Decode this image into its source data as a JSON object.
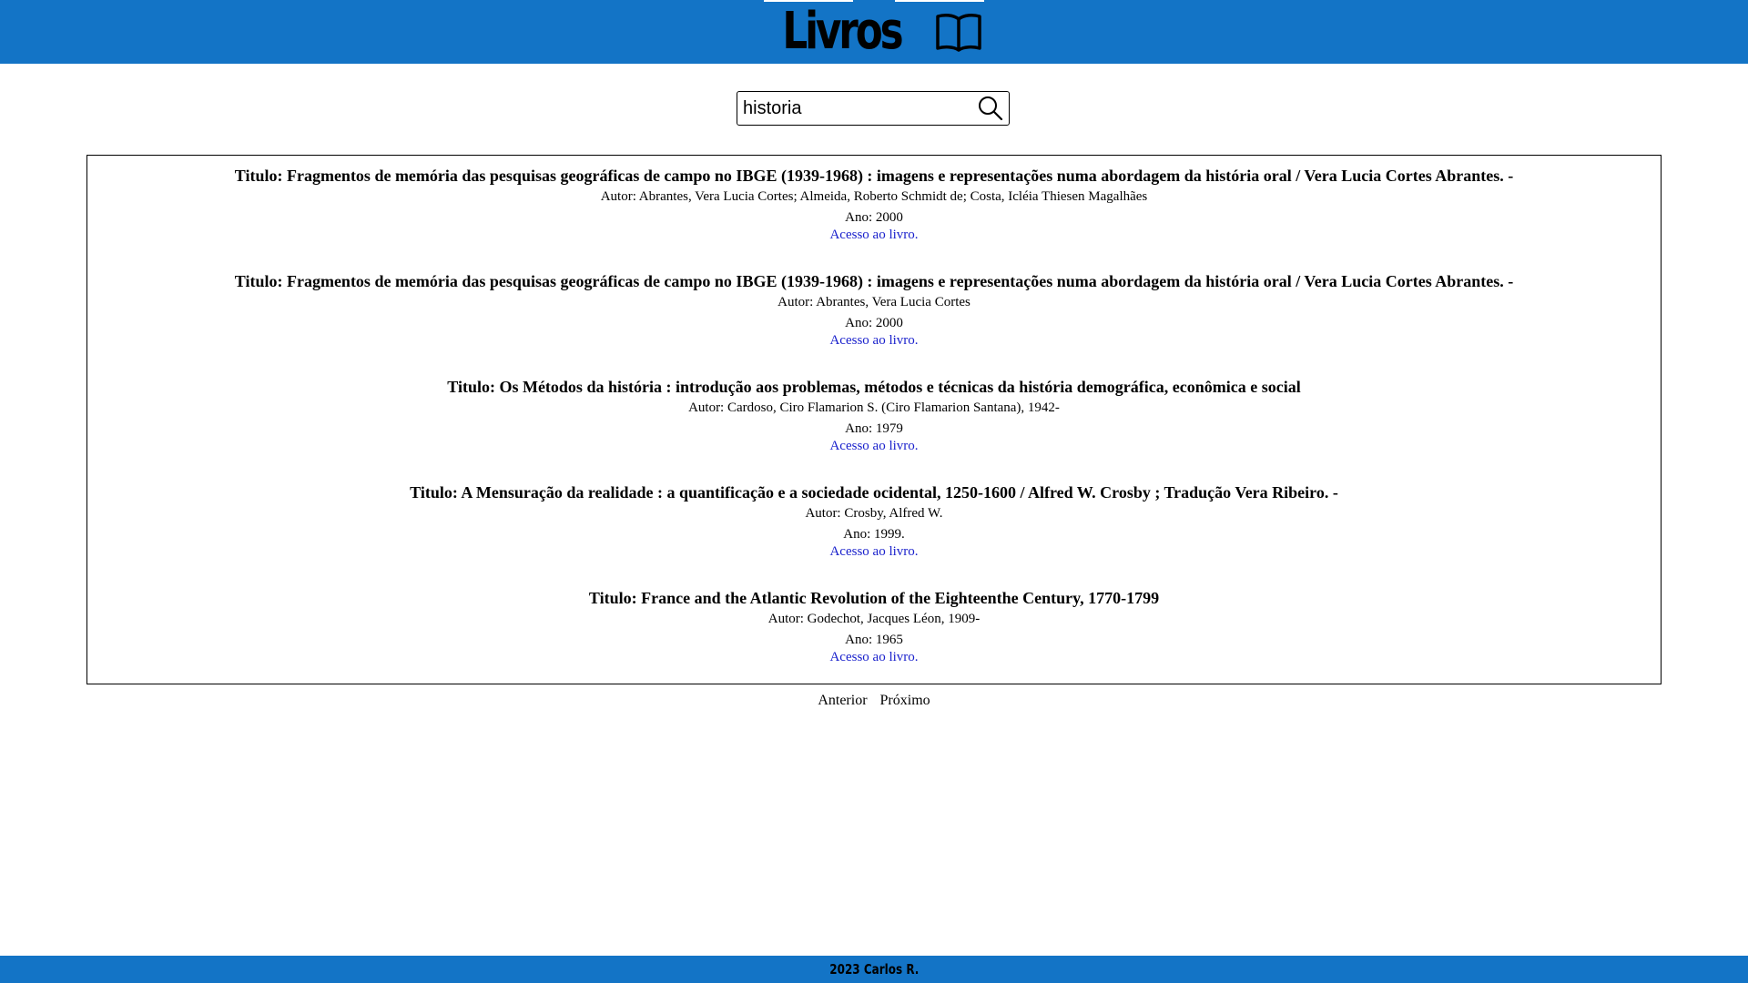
{
  "header": {
    "title": "Livros",
    "icon": "open-book-icon",
    "background": "#1374c6"
  },
  "search": {
    "value": "historia",
    "icon": "search-icon"
  },
  "results": [
    {
      "title": "Titulo: Fragmentos de memória das pesquisas geográficas de campo no IBGE (1939-1968) : imagens e representações numa abordagem da história oral / Vera Lucia Cortes Abrantes. -",
      "author": "Autor: Abrantes, Vera Lucia Cortes; Almeida, Roberto Schmidt de; Costa, Icléia Thiesen Magalhães",
      "year": "Ano: 2000",
      "link": "Acesso ao livro."
    },
    {
      "title": "Titulo: Fragmentos de memória das pesquisas geográficas de campo no IBGE (1939-1968) : imagens e representações numa abordagem da história oral / Vera Lucia Cortes Abrantes. -",
      "author": "Autor: Abrantes, Vera Lucia Cortes",
      "year": "Ano: 2000",
      "link": "Acesso ao livro."
    },
    {
      "title": "Titulo: Os Métodos da história : introdução aos problemas, métodos e técnicas da história demográfica, econômica e social",
      "author": "Autor: Cardoso, Ciro Flamarion S. (Ciro Flamarion Santana), 1942-",
      "year": "Ano: 1979",
      "link": "Acesso ao livro."
    },
    {
      "title": "Titulo: A Mensuração da realidade : a quantificação e a sociedade ocidental, 1250-1600 / Alfred W. Crosby ; Tradução Vera Ribeiro. -",
      "author": "Autor: Crosby, Alfred W.",
      "year": "Ano: 1999.",
      "link": "Acesso ao livro."
    },
    {
      "title": "Titulo: France and the Atlantic Revolution of the Eighteenthe Century, 1770-1799",
      "author": "Autor: Godechot, Jacques Léon, 1909-",
      "year": "Ano: 1965",
      "link": "Acesso ao livro."
    }
  ],
  "pagination": {
    "previous": "Anterior",
    "next": "Próximo"
  },
  "footer": {
    "text": "2023 Carlos R."
  },
  "colors": {
    "accent": "#1374c6",
    "link": "#1a21cc"
  }
}
